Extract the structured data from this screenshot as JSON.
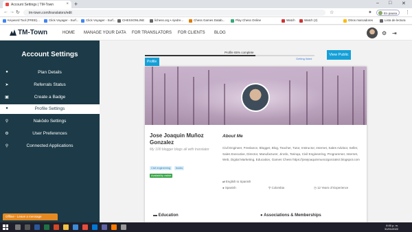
{
  "browser": {
    "tab_title": "Account Settings | TM-Town",
    "url": "tm-town.com/translators/edit",
    "profile_label": "En pausa",
    "bookmarks": [
      "Keyword Tool (FREE)...",
      "Click Voyager - Surf...",
      "Click Voyager - Surf...",
      "CHESSONLINE",
      "lichess.org • Ajedre...",
      "Chess Games Datab...",
      "Play Chess Online",
      "Watch",
      "Watch (2)",
      "Otros marcadores",
      "Lista de lectura"
    ]
  },
  "site": {
    "logo": "TM-Town",
    "nav": [
      "HOME",
      "MANAGE YOUR DATA",
      "FOR TRANSLATORS",
      "FOR CLIENTS",
      "BLOG"
    ]
  },
  "sidebar": {
    "title": "Account Settings",
    "items": [
      {
        "label": "Plan Details",
        "icon": "info-icon"
      },
      {
        "label": "Referrals Status",
        "icon": "send-icon"
      },
      {
        "label": "Create a Badge",
        "icon": "badge-icon"
      },
      {
        "label": "Profile Settings",
        "icon": "user-icon",
        "active": true
      },
      {
        "label": "Nakōdo Settings",
        "icon": "search-icon"
      },
      {
        "label": "User Preferences",
        "icon": "gear-icon"
      },
      {
        "label": "Connected Applications",
        "icon": "search-icon"
      }
    ],
    "offline_chip": "Offline - Leave a message"
  },
  "profile": {
    "progress_label": "Profile 65% complete",
    "progress_value": 0.65,
    "getting_listed": "Getting listed",
    "view_public": "View Public",
    "tab_label": "Profile",
    "name": "Jose Joaquin Muñoz Gonzalez",
    "tagline": "My 100 blogger blogs all with translator",
    "tags": [
      "Civil engineering",
      "books"
    ],
    "availability": "Availability visible",
    "about_title": "About Me",
    "about_text": "Civil Engineer, Freelance, Blogger, Blog, Teacher, Tutor, Instructor, Internet, Sales Advisor, Seller, Sales Executive, Director, Manufacturer, Jinrdo, Tarinqa, Civil Engineering, Programmer, Internet, Web, Digital Marketing, Education, Games Chess https://josejoaquinmunozgonzalez.blogspot.com",
    "language_pair": "English to Spanish",
    "native_language": "Spanish",
    "country": "Colombia",
    "experience": "12 Years of Experience",
    "education_heading": "Education",
    "associations_heading": "Associations & Memberships"
  },
  "taskbar": {
    "time": "8:00 p. m.",
    "date": "31/01/2022"
  }
}
